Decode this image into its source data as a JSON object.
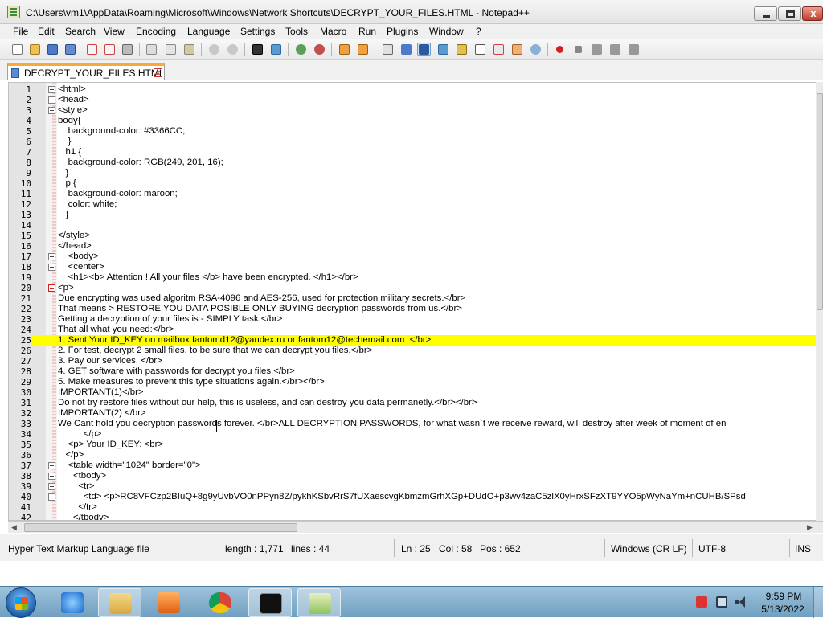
{
  "window": {
    "title": "C:\\Users\\vm1\\AppData\\Roaming\\Microsoft\\Windows\\Network Shortcuts\\DECRYPT_YOUR_FILES.HTML - Notepad++",
    "close_glyph": "x"
  },
  "menu": [
    "File",
    "Edit",
    "Search",
    "View",
    "Encoding",
    "Language",
    "Settings",
    "Tools",
    "Macro",
    "Run",
    "Plugins",
    "Window",
    "?"
  ],
  "tab": {
    "label": "DECRYPT_YOUR_FILES.HTML",
    "close_glyph": "x"
  },
  "editor": {
    "current_line": 25,
    "lines": [
      "<html>",
      "<head>",
      "<style>",
      "body{",
      "    background-color: #3366CC;",
      "    }",
      "   h1 {",
      "    background-color: RGB(249, 201, 16);",
      "   }",
      "   p {",
      "    background-color: maroon;",
      "    color: white;",
      "   }",
      "",
      "</style>",
      "</head>",
      "    <body>",
      "    <center>",
      "    <h1><b> Attention ! All your files </b> have been encrypted. </h1></br>",
      "<p>",
      "Due encrypting was used algoritm RSA-4096 and AES-256, used for protection military secrets.</br>",
      "That means > RESTORE YOU DATA POSIBLE ONLY BUYING decryption passwords from us.</br>",
      "Getting a decryption of your files is - SIMPLY task.</br>",
      "That all what you need:</br>",
      "1. Sent Your ID_KEY on mailbox fantomd12@yandex.ru or fantom12@techemail.com  </br>",
      "2. For test, decrypt 2 small files, to be sure that we can decrypt you files.</br>",
      "3. Pay our services. </br>",
      "4. GET software with passwords for decrypt you files.</br>",
      "5. Make measures to prevent this type situations again.</br></br>",
      "IMPORTANT(1)</br>",
      "Do not try restore files without our help, this is useless, and can destroy you data permanetly.</br></br>",
      "IMPORTANT(2) </br>",
      "We Cant hold you decryption passwords forever. </br>ALL DECRYPTION PASSWORDS, for what wasn`t we receive reward, will destroy after week of moment of en",
      "          </p>",
      "    <p> Your ID_KEY: <br>",
      "   </p>",
      "    <table width=\"1024\" border=\"0\">",
      "      <tbody>",
      "        <tr>",
      "          <td> <p>RC8VFCzp2BIuQ+8g9yUvbVO0nPPyn8Z/pykhKSbvRrS7fUXaescvgKbmzmGrhXGp+DUdO+p3wv4zaC5zlX0yHrxSFzXT9YYO5pWyNaYm+nCUHB/SPsd",
      "        </tr>",
      "      </tbody>"
    ]
  },
  "status": {
    "file_type": "Hyper Text Markup Language file",
    "length": "length : 1,771",
    "lines": "lines : 44",
    "ln": "Ln : 25",
    "col": "Col : 58",
    "pos": "Pos : 652",
    "eol": "Windows (CR LF)",
    "encoding": "UTF-8",
    "mode": "INS"
  },
  "taskbar": {
    "apps": [
      "internet-explorer-icon",
      "file-explorer-icon",
      "media-player-icon",
      "chrome-icon",
      "cmd-icon",
      "notepadpp-icon"
    ],
    "clock_time": "9:59 PM",
    "clock_date": "5/13/2022"
  }
}
